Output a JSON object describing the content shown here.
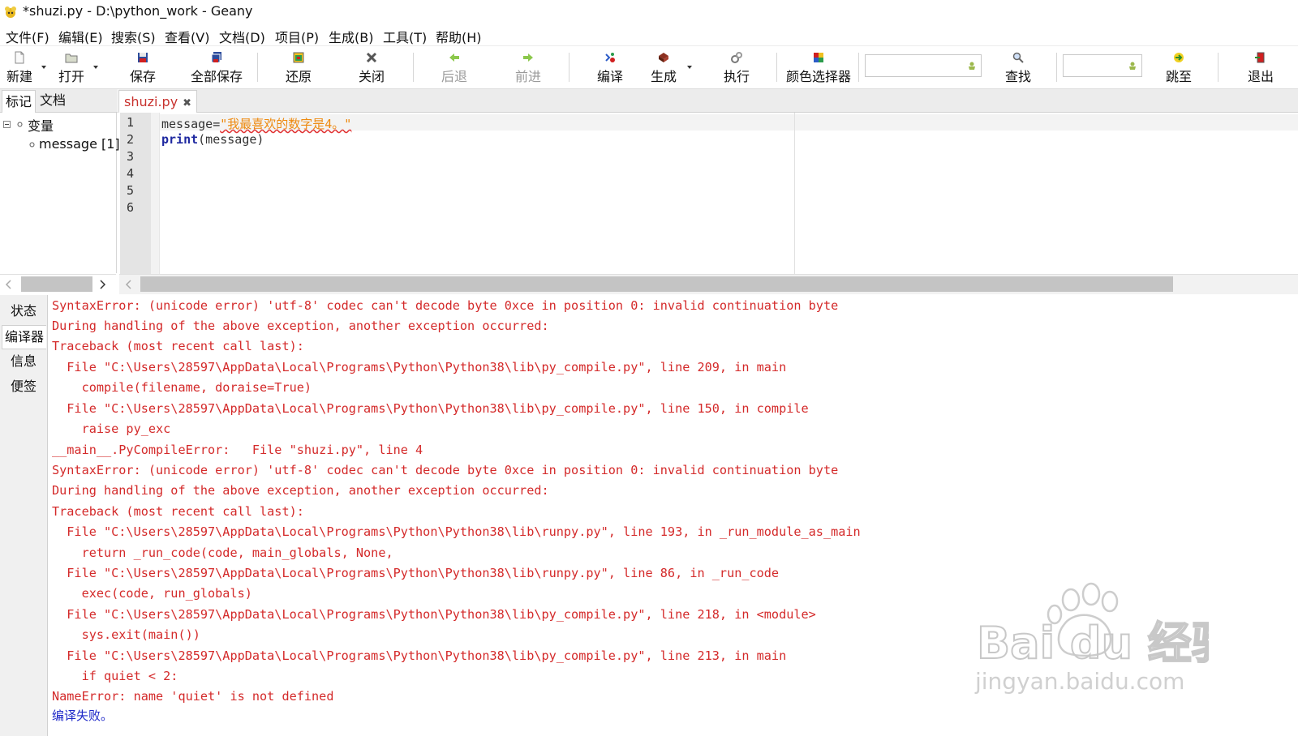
{
  "window": {
    "title": "*shuzi.py - D:\\python_work - Geany"
  },
  "menu": [
    "文件(F)",
    "编辑(E)",
    "搜索(S)",
    "查看(V)",
    "文档(D)",
    "项目(P)",
    "生成(B)",
    "工具(T)",
    "帮助(H)"
  ],
  "toolbar": {
    "new": "新建",
    "open": "打开",
    "save": "保存",
    "save_all": "全部保存",
    "revert": "还原",
    "close": "关闭",
    "back": "后退",
    "forward": "前进",
    "compile": "编译",
    "build": "生成",
    "execute": "执行",
    "color_chooser": "颜色选择器",
    "find": "查找",
    "goto": "跳至",
    "quit": "退出",
    "search_value": "",
    "goto_value": ""
  },
  "sidebar": {
    "tabs": [
      "标记",
      "文档"
    ],
    "tree": {
      "group": "变量",
      "items": [
        "message [1]"
      ]
    }
  },
  "editor": {
    "tab_label": "shuzi.py",
    "line_numbers": [
      "1",
      "2",
      "3",
      "4",
      "5",
      "6"
    ],
    "code": {
      "l1_ident": "message=",
      "l1_string": "\"我最喜欢的数字是4。\"",
      "l2_keyword": "print",
      "l2_rest": "(message)"
    }
  },
  "message_window": {
    "tabs": [
      "状态",
      "编译器",
      "信息",
      "便签"
    ],
    "output": [
      "SyntaxError: (unicode error) 'utf-8' codec can't decode byte 0xce in position 0: invalid continuation byte",
      "During handling of the above exception, another exception occurred:",
      "Traceback (most recent call last):",
      "  File \"C:\\Users\\28597\\AppData\\Local\\Programs\\Python\\Python38\\lib\\py_compile.py\", line 209, in main",
      "    compile(filename, doraise=True)",
      "  File \"C:\\Users\\28597\\AppData\\Local\\Programs\\Python\\Python38\\lib\\py_compile.py\", line 150, in compile",
      "    raise py_exc",
      "__main__.PyCompileError:   File \"shuzi.py\", line 4",
      "SyntaxError: (unicode error) 'utf-8' codec can't decode byte 0xce in position 0: invalid continuation byte",
      "During handling of the above exception, another exception occurred:",
      "Traceback (most recent call last):",
      "  File \"C:\\Users\\28597\\AppData\\Local\\Programs\\Python\\Python38\\lib\\runpy.py\", line 193, in _run_module_as_main",
      "    return _run_code(code, main_globals, None,",
      "  File \"C:\\Users\\28597\\AppData\\Local\\Programs\\Python\\Python38\\lib\\runpy.py\", line 86, in _run_code",
      "    exec(code, run_globals)",
      "  File \"C:\\Users\\28597\\AppData\\Local\\Programs\\Python\\Python38\\lib\\py_compile.py\", line 218, in <module>",
      "    sys.exit(main())",
      "  File \"C:\\Users\\28597\\AppData\\Local\\Programs\\Python\\Python38\\lib\\py_compile.py\", line 213, in main",
      "    if quiet < 2:",
      "NameError: name 'quiet' is not defined"
    ],
    "status": "编译失败。"
  },
  "watermark": {
    "brand": "Bai du 经验",
    "url": "jingyan.baidu.com"
  },
  "colors": {
    "error_text": "#d42a2a",
    "status_text": "#1e28c8",
    "keyword": "#1e28a0",
    "string": "#ee8a10",
    "tab_label": "#c8322e"
  }
}
